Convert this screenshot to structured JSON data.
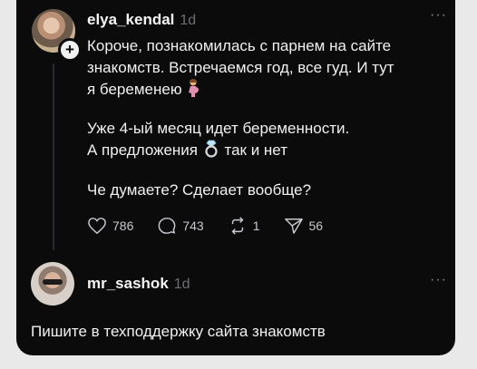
{
  "post": {
    "username": "elya_kendal",
    "time": "1d",
    "more": "···",
    "para1_line1": "Короче, познакомилась с парнем на сайте",
    "para1_line2": "знакомств. Встречаемся год, все гуд. И тут",
    "para1_line3": "я беременею",
    "para2_line1": "Уже 4-ый месяц идет беременности.",
    "para2_line2a": "А предложения",
    "para2_line2b": "так и нет",
    "para3": "Че думаете? Сделает вообще?",
    "likes": "786",
    "comments": "743",
    "reposts": "1",
    "shares": "56"
  },
  "reply": {
    "username": "mr_sashok",
    "time": "1d",
    "more": "···",
    "text": "Пишите в техподдержку сайта знакомств"
  }
}
